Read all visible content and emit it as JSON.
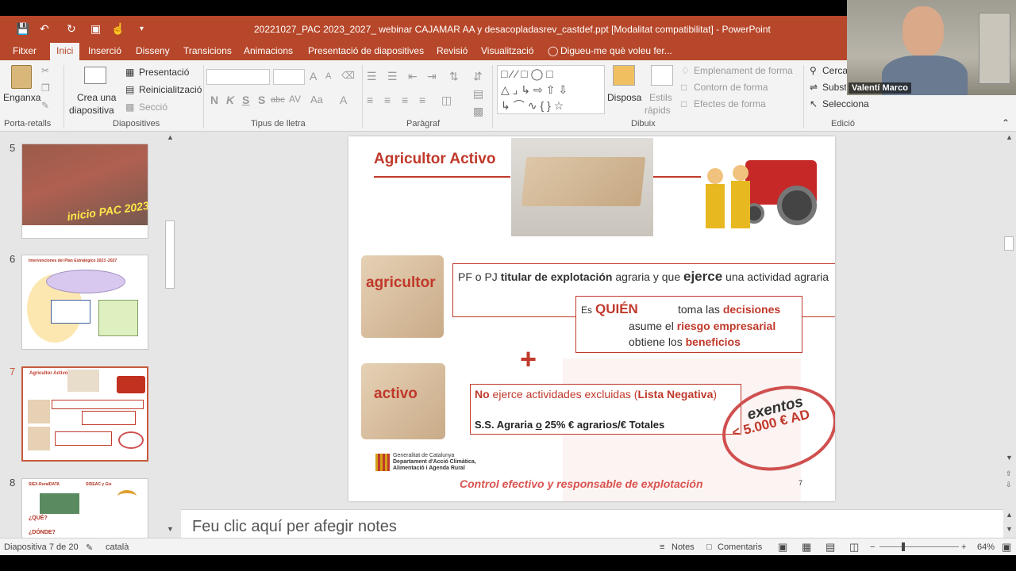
{
  "window": {
    "title": "20221027_PAC 2023_2027_ webinar CAJAMAR AA y desacopladasrev_castdef.ppt [Modalitat compatibilitat] - PowerPoint"
  },
  "menu": {
    "tabs": [
      "Fitxer",
      "Inici",
      "Inserció",
      "Disseny",
      "Transicions",
      "Animacions",
      "Presentació de diapositives",
      "Revisió",
      "Visualització"
    ],
    "active": "Inici",
    "tell_me": "Digueu-me què voleu fer..."
  },
  "ribbon": {
    "clipboard": {
      "paste": "Enganxa",
      "label": "Porta-retalls"
    },
    "slides": {
      "new_slide_line1": "Crea una",
      "new_slide_line2": "diapositiva",
      "layout": "Presentació",
      "reset": "Reinicialització",
      "section": "Secció",
      "label": "Diapositives"
    },
    "font": {
      "label": "Tipus de lletra",
      "bold": "N",
      "italic": "K",
      "underline": "S",
      "shadow": "S",
      "strike": "abc",
      "spacing": "AV",
      "case": "Aa",
      "grow": "A",
      "shrink": "A"
    },
    "paragraph": {
      "label": "Paràgraf"
    },
    "drawing": {
      "arrange": "Disposa",
      "quick_styles_line1": "Estils",
      "quick_styles_line2": "ràpids",
      "fill": "Emplenament de forma",
      "outline": "Contorn de forma",
      "effects": "Efectes de forma",
      "label": "Dibuix"
    },
    "editing": {
      "find": "Cerca",
      "replace": "Substitueix",
      "select": "Selecciona",
      "label": "Edició"
    }
  },
  "thumbnails": [
    {
      "num": "5",
      "caption": "inicio PAC 2023"
    },
    {
      "num": "6",
      "caption": "Intervenciones del Plan Estratégico 2023 -2027"
    },
    {
      "num": "7",
      "caption": "Agricultor Activo",
      "selected": true
    },
    {
      "num": "8",
      "caption": "SIEX-RuralDATA"
    }
  ],
  "thumb8": {
    "sideac": "SIDEAC y Gis",
    "que": "¿QUÉ?",
    "donde": "¿DÓNDE?"
  },
  "slide": {
    "title": "Agricultor Activo",
    "piece_top": "agricultor",
    "piece_bottom": "activo",
    "def_prefix": "PF o PJ ",
    "def_bold": "titular de explotación",
    "def_mid": " agraria y que ",
    "def_ejerce": "ejerce",
    "def_end": " una actividad agraria",
    "es": "Es",
    "quien": "QUIÉN",
    "line1_pre": "toma las ",
    "line1_bold": "decisiones",
    "line2_pre": "asume el ",
    "line2_bold": "riesgo empresarial",
    "line3_pre": "obtiene los ",
    "line3_bold": "beneficios",
    "plus": "+",
    "no_bold": "No",
    "no_rest": " ejerce actividades excluidas (",
    "no_list": "Lista Negativa",
    "no_close": ")",
    "ss_text": "S.S. Agraria ",
    "ss_o": "o",
    "ss_rest": "  25% € agrarios/€ Totales",
    "stamp_top": "< 5.000 € AD",
    "stamp_word": "exentos",
    "org_line1": "Generalitat de Catalunya",
    "org_line2": "Departament d'Acció Climàtica,",
    "org_line3": "Alimentació i Agenda Rural",
    "footer": "Control efectivo y responsable de explotación",
    "page": "7"
  },
  "notes": {
    "placeholder": "Feu clic aquí per afegir notes"
  },
  "status": {
    "slide_info": "Diapositiva 7 de 20",
    "language": "català",
    "notes_btn": "Notes",
    "comments_btn": "Comentaris",
    "zoom": "64%"
  },
  "webcam": {
    "name": "Valentí Marco"
  },
  "colors": {
    "accent": "#b7472a",
    "slide_red": "#c0392b"
  }
}
